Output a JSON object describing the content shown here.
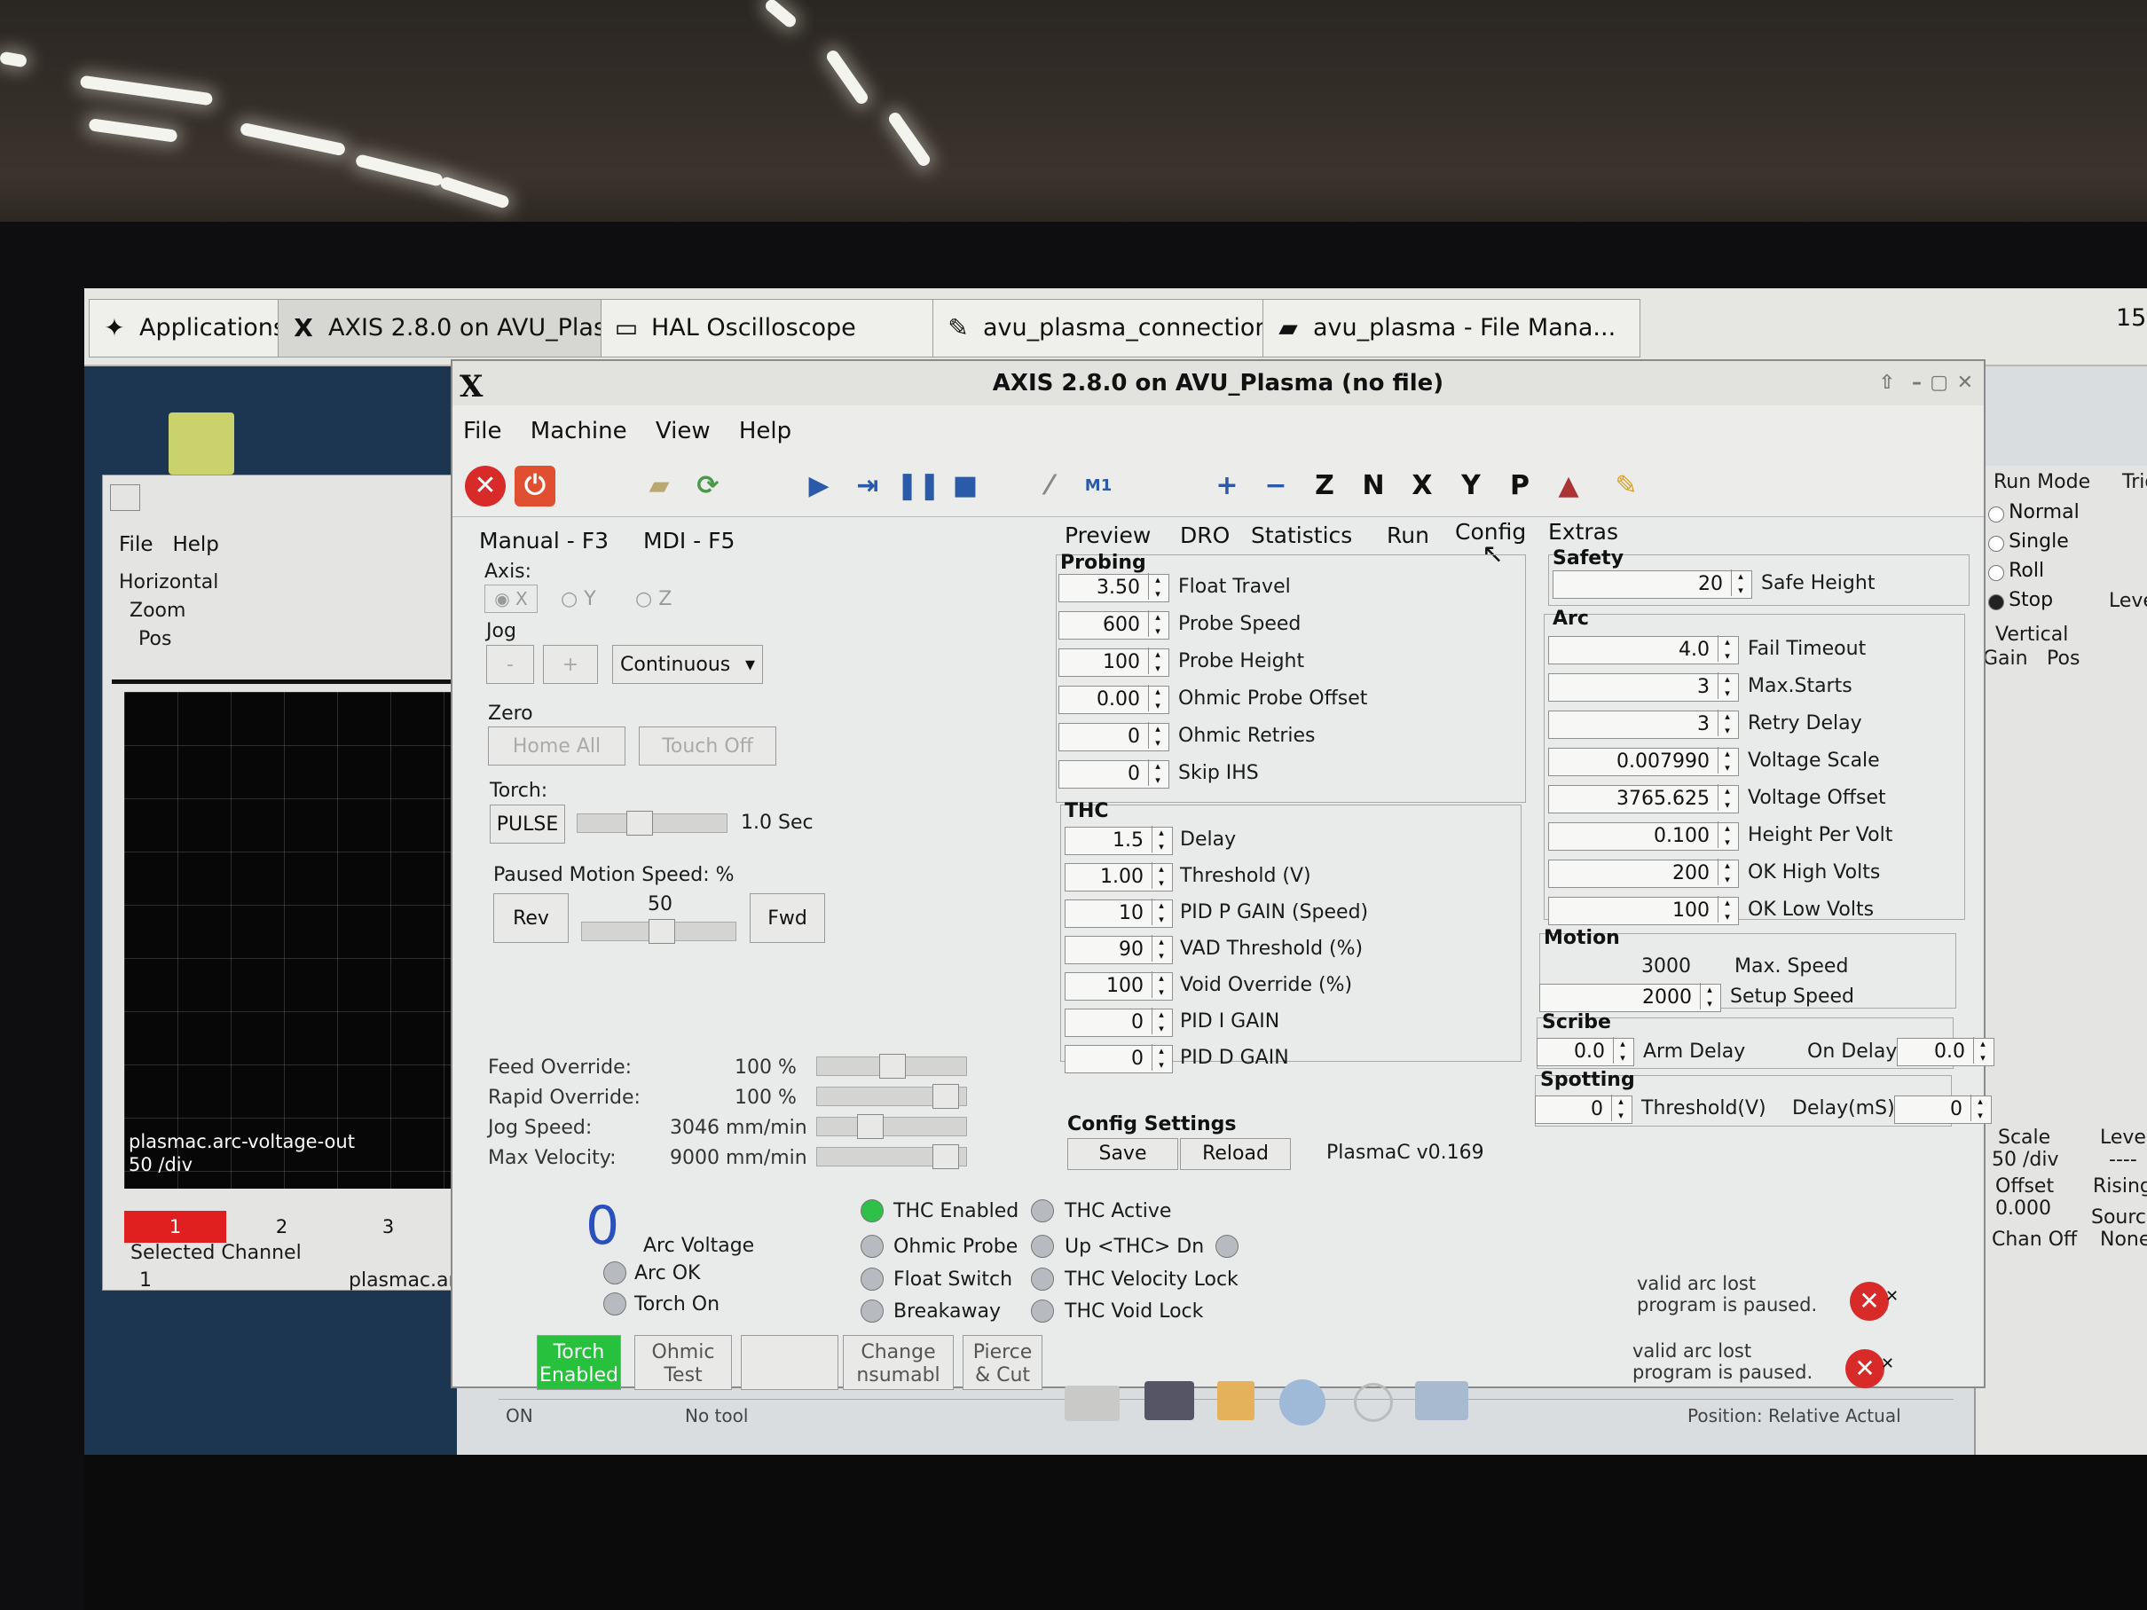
{
  "taskbar": {
    "items": [
      {
        "label": "Applications",
        "icon": "applications-icon"
      },
      {
        "label": "AXIS 2.8.0 on AVU_Plas...",
        "icon": "x-logo-icon"
      },
      {
        "label": "HAL Oscilloscope",
        "icon": "window-icon"
      },
      {
        "label": "avu_plasma_connection...",
        "icon": "text-editor-icon"
      },
      {
        "label": "avu_plasma - File Mana...",
        "icon": "folder-icon"
      }
    ],
    "clock": "15"
  },
  "scope": {
    "menu": [
      "File",
      "Help"
    ],
    "horizontal": "Horizontal",
    "zoom": "Zoom",
    "pos": "Pos",
    "trace_label": "plasmac.arc-voltage-out",
    "trace_scale": "50 /div",
    "channels": [
      "1",
      "2",
      "3"
    ],
    "selected_channel_label": "Selected Channel",
    "selected_channel_num": "1",
    "selected_channel_name": "plasmac.ar"
  },
  "window": {
    "title": "AXIS 2.8.0 on AVU_Plasma (no file)",
    "menus": [
      "File",
      "Machine",
      "View",
      "Help"
    ]
  },
  "left_tabs": [
    "Manual - F3",
    "MDI - F5"
  ],
  "manual": {
    "axis_label": "Axis:",
    "axes": [
      "X",
      "Y",
      "Z"
    ],
    "jog_label": "Jog",
    "jog_minus": "-",
    "jog_plus": "+",
    "jog_mode": "Continuous",
    "zero_label": "Zero",
    "home_all": "Home All",
    "touch_off": "Touch Off",
    "torch_label": "Torch:",
    "pulse": "PULSE",
    "pulse_time": "1.0 Sec",
    "paused_motion": "Paused Motion Speed: %",
    "rev": "Rev",
    "fwd": "Fwd",
    "paused_speed": "50"
  },
  "overrides": [
    {
      "label": "Feed Override:",
      "value": "100 %"
    },
    {
      "label": "Rapid Override:",
      "value": "100 %"
    },
    {
      "label": "Jog Speed:",
      "value": "3046 mm/min"
    },
    {
      "label": "Max Velocity:",
      "value": "9000 mm/min"
    }
  ],
  "right_tabs": [
    "Preview",
    "DRO",
    "Statistics",
    "Run",
    "Config",
    "Extras"
  ],
  "probing": {
    "title": "Probing",
    "rows": [
      {
        "value": "3.50",
        "label": "Float Travel"
      },
      {
        "value": "600",
        "label": "Probe Speed"
      },
      {
        "value": "100",
        "label": "Probe Height"
      },
      {
        "value": "0.00",
        "label": "Ohmic Probe Offset"
      },
      {
        "value": "0",
        "label": "Ohmic Retries"
      },
      {
        "value": "0",
        "label": "Skip IHS"
      }
    ]
  },
  "thc": {
    "title": "THC",
    "rows": [
      {
        "value": "1.5",
        "label": "Delay"
      },
      {
        "value": "1.00",
        "label": "Threshold (V)"
      },
      {
        "value": "10",
        "label": "PID P GAIN (Speed)"
      },
      {
        "value": "90",
        "label": "VAD Threshold (%)"
      },
      {
        "value": "100",
        "label": "Void Override (%)"
      },
      {
        "value": "0",
        "label": "PID I GAIN"
      },
      {
        "value": "0",
        "label": "PID D GAIN"
      }
    ]
  },
  "config_settings": {
    "title": "Config Settings",
    "save": "Save",
    "reload": "Reload",
    "version": "PlasmaC v0.169"
  },
  "safety": {
    "title": "Safety",
    "rows": [
      {
        "value": "20",
        "label": "Safe Height"
      }
    ]
  },
  "arc": {
    "title": "Arc",
    "rows": [
      {
        "value": "4.0",
        "label": "Fail Timeout"
      },
      {
        "value": "3",
        "label": "Max.Starts"
      },
      {
        "value": "3",
        "label": "Retry Delay"
      },
      {
        "value": "0.007990",
        "label": "Voltage Scale"
      },
      {
        "value": "3765.625",
        "label": "Voltage Offset"
      },
      {
        "value": "0.100",
        "label": "Height Per Volt"
      },
      {
        "value": "200",
        "label": "OK High Volts"
      },
      {
        "value": "100",
        "label": "OK Low Volts"
      }
    ]
  },
  "motion": {
    "title": "Motion",
    "max_speed_value": "3000",
    "max_speed_label": "Max. Speed",
    "setup_speed_value": "2000",
    "setup_speed_label": "Setup Speed"
  },
  "scribe": {
    "title": "Scribe",
    "arm_delay_value": "0.0",
    "arm_delay_label": "Arm Delay",
    "on_delay_label": "On Delay",
    "on_delay_value": "0.0"
  },
  "spotting": {
    "title": "Spotting",
    "threshold_value": "0",
    "threshold_label": "Threshold(V)",
    "delay_label": "Delay(mS)",
    "delay_value": "0"
  },
  "status": {
    "arc_voltage_value": "0",
    "arc_voltage_label": "Arc Voltage",
    "arc_ok": "Arc OK",
    "torch_on": "Torch On",
    "thc_enabled": "THC Enabled",
    "ohmic_probe": "Ohmic Probe",
    "float_switch": "Float Switch",
    "breakaway": "Breakaway",
    "thc_active": "THC Active",
    "up_thc": "Up <THC> Dn",
    "thc_velocity_lock": "THC Velocity Lock",
    "thc_void_lock": "THC Void Lock"
  },
  "bottom_buttons": [
    "Torch\nEnabled",
    "Ohmic\nTest",
    "Change\nnsumabl",
    "Pierce\n& Cut"
  ],
  "statusbar": {
    "state": "ON",
    "tool": "No tool",
    "position": "Position: Relative Actual"
  },
  "notifications": [
    {
      "text": "valid arc lost\nprogram is paused."
    },
    {
      "text": "valid arc lost\nprogram is paused."
    }
  ],
  "scope_right": {
    "run_mode": "Run Mode",
    "trig": "Trig",
    "modes": [
      "Normal",
      "Single",
      "Roll",
      "Stop"
    ],
    "vertical": "Vertical",
    "gain": "Gain",
    "pos": "Pos",
    "level": "Leve",
    "scale_label": "Scale",
    "scale_value": "50 /div",
    "offset_label": "Offset",
    "offset_value": "0.000",
    "chan_off": "Chan Off",
    "level_label": "Level",
    "level_value": "----",
    "rising": "Rising",
    "source_label": "Source",
    "source_value": "None"
  },
  "colors": {
    "accent_green": "#2fc04a",
    "estop_red": "#d92a2a",
    "torch_enabled_bg": "#27c13e"
  }
}
